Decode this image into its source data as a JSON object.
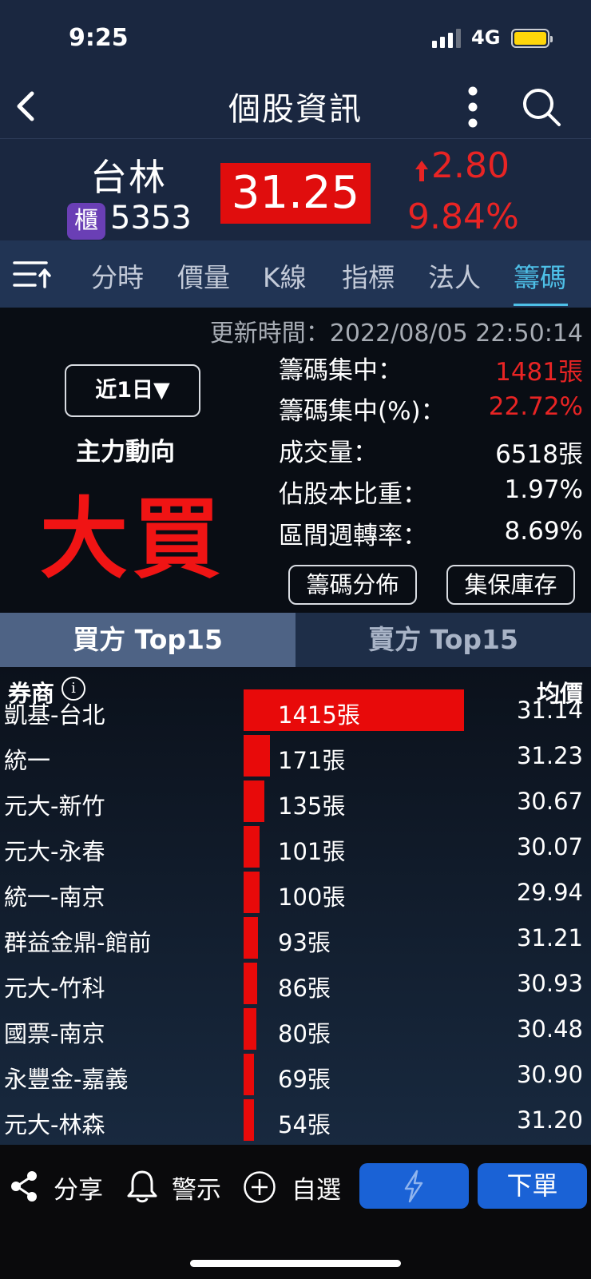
{
  "status_bar": {
    "time": "9:25",
    "network": "4G"
  },
  "nav": {
    "title": "個股資訊"
  },
  "quote": {
    "name": "台林",
    "market_badge": "櫃",
    "code": "5353",
    "price": "31.25",
    "change": "2.80",
    "change_pct": "9.84%",
    "up_color": "#e82424",
    "price_bg": "#e00d0d"
  },
  "tabs": [
    {
      "label": "分時"
    },
    {
      "label": "價量"
    },
    {
      "label": "K線"
    },
    {
      "label": "指標"
    },
    {
      "label": "法人"
    },
    {
      "label": "籌碼",
      "active": true
    }
  ],
  "summary": {
    "update_time": "更新時間：2022/08/05 22:50:14",
    "range_button": "近1日▼",
    "trend_label": "主力動向",
    "trend_value": "大買",
    "metrics": [
      {
        "label": "籌碼集中：",
        "value": "1481張",
        "highlight": true
      },
      {
        "label": "籌碼集中(%)：",
        "value": "22.72%",
        "highlight": true
      },
      {
        "label": "成交量：",
        "value": "6518張",
        "highlight": false
      },
      {
        "label": "佔股本比重：",
        "value": "1.97%",
        "highlight": false
      },
      {
        "label": "區間週轉率：",
        "value": "8.69%",
        "highlight": false
      }
    ],
    "buttons": {
      "distribution": "籌碼分佈",
      "custody": "集保庫存"
    }
  },
  "segment": {
    "buy": "買方 Top15",
    "sell": "賣方 Top15"
  },
  "table": {
    "header_broker": "券商",
    "header_avg": "均價",
    "max_volume": 1415,
    "rows": [
      {
        "broker": "凱基-台北",
        "volume": 1415,
        "volume_text": "1415張",
        "avg": "31.14"
      },
      {
        "broker": "統一",
        "volume": 171,
        "volume_text": "171張",
        "avg": "31.23"
      },
      {
        "broker": "元大-新竹",
        "volume": 135,
        "volume_text": "135張",
        "avg": "30.67"
      },
      {
        "broker": "元大-永春",
        "volume": 101,
        "volume_text": "101張",
        "avg": "30.07"
      },
      {
        "broker": "統一-南京",
        "volume": 100,
        "volume_text": "100張",
        "avg": "29.94"
      },
      {
        "broker": "群益金鼎-館前",
        "volume": 93,
        "volume_text": "93張",
        "avg": "31.21"
      },
      {
        "broker": "元大-竹科",
        "volume": 86,
        "volume_text": "86張",
        "avg": "30.93"
      },
      {
        "broker": "國票-南京",
        "volume": 80,
        "volume_text": "80張",
        "avg": "30.48"
      },
      {
        "broker": "永豐金-嘉義",
        "volume": 69,
        "volume_text": "69張",
        "avg": "30.90"
      },
      {
        "broker": "元大-林森",
        "volume": 54,
        "volume_text": "54張",
        "avg": "31.20"
      }
    ]
  },
  "bottom_bar": {
    "share": "分享",
    "alert": "警示",
    "watchlist": "自選",
    "order": "下單"
  }
}
